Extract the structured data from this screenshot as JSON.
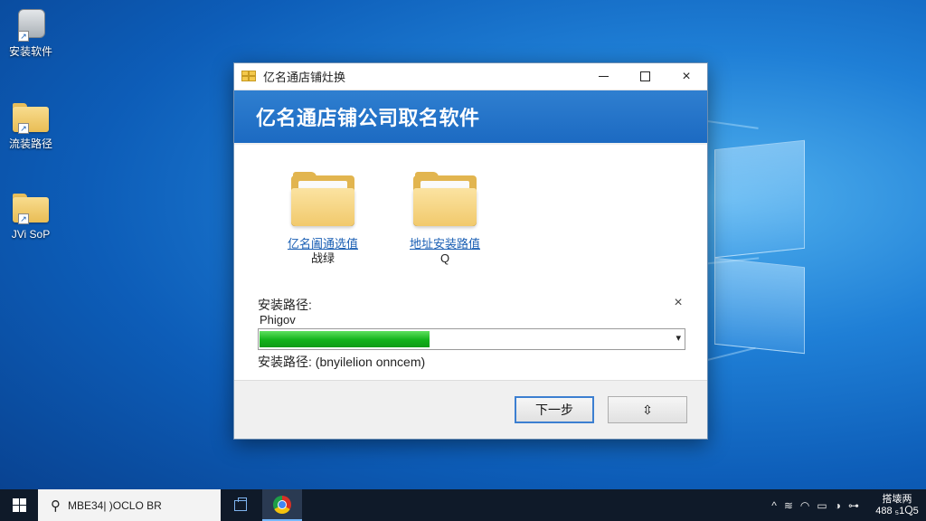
{
  "desktop": {
    "icons": [
      {
        "label": "安装软件",
        "type": "disk"
      },
      {
        "label": "流装路径",
        "type": "folder"
      },
      {
        "label": "JVi SoP",
        "type": "folder"
      }
    ]
  },
  "dialog": {
    "window_title": "亿名通店铺灶换",
    "heading": "亿名通店铺公司取名软件",
    "folders": [
      {
        "link": "亿名阖通选值",
        "sub": "战绿"
      },
      {
        "link": "地址安装路值",
        "sub": "Q"
      }
    ],
    "path_label": "安装路径:",
    "path_value": "Phigov",
    "progress": 0.4,
    "status_text": "安装路径: (bnyilelion onncem)",
    "next_button": "下一步",
    "second_button": "⇳",
    "close_glyph": "×",
    "minimize_glyph": "—",
    "path_close_glyph": "×",
    "dropdown_glyph": "▾"
  },
  "taskbar": {
    "search_text": "MBE34| )OCLO BR",
    "search_icon_glyph": "⚲",
    "tray_icons": [
      "^",
      "≋",
      "◠",
      "▭",
      "◑",
      "⊶"
    ],
    "clock_line1": "搭壊两",
    "clock_line2": "488 ₅1Ⴍ5"
  },
  "colors": {
    "accent": "#1c6ac2",
    "progress": "#12b21a",
    "taskbar": "#0f1a29"
  }
}
